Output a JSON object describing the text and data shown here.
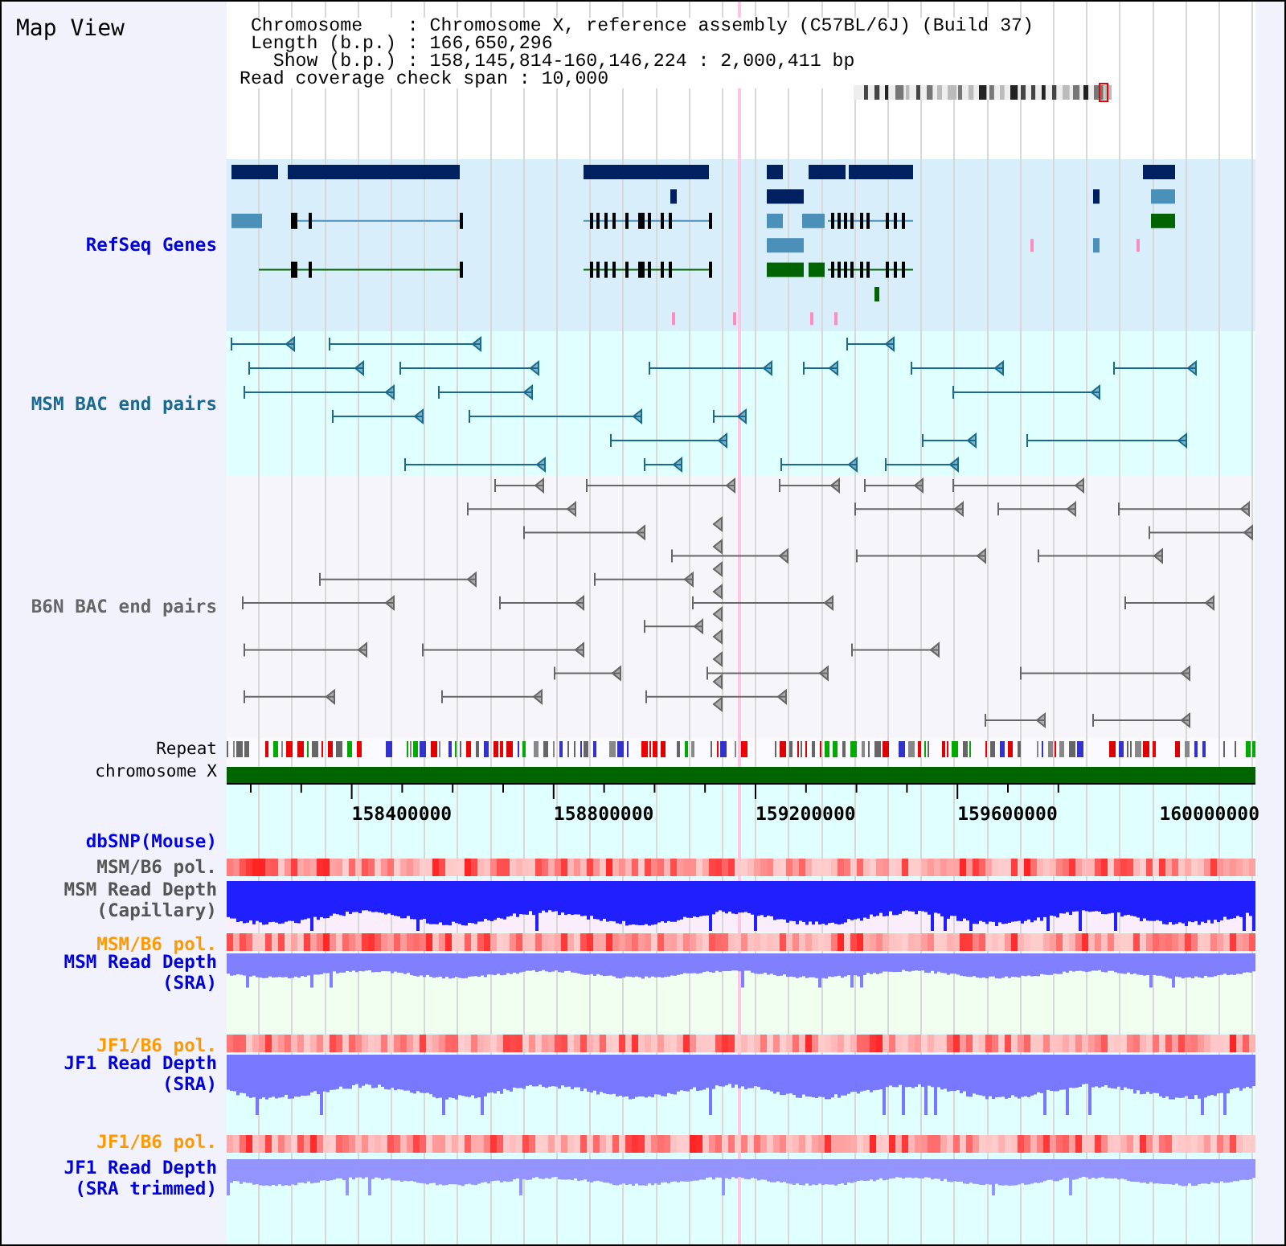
{
  "title": "Map View",
  "info": [
    " Chromosome    : Chromosome X, reference assembly (C57BL/6J) (Build 37)",
    " Length (b.p.) : 166,650,296",
    "   Show (b.p.) : 158,145,814-160,146,224 : 2,000,411 bp",
    "Read coverage check span : 10,000"
  ],
  "tracks": [
    {
      "kind": "genes",
      "label": "RefSeq Genes",
      "color": "#0000dd"
    },
    {
      "kind": "bac",
      "label": "MSM BAC end pairs",
      "color": "#1a6a90"
    },
    {
      "kind": "bac",
      "label": "B6N BAC end pairs",
      "color": "#666666"
    },
    {
      "kind": "repeat",
      "label": "Repeat",
      "color": "#000000"
    },
    {
      "kind": "chromosome",
      "label": "chromosome X",
      "color": "#000000"
    },
    {
      "kind": "axis",
      "ticks": [
        "158400000",
        "158800000",
        "159200000",
        "159600000",
        "160000000"
      ]
    },
    {
      "kind": "snp",
      "label": "dbSNP(Mouse)",
      "color": "#0000ee"
    },
    {
      "kind": "pol",
      "label": "MSM/B6 pol.",
      "color": "#555555"
    },
    {
      "kind": "depth",
      "label": "MSM Read Depth (Capillary)",
      "color": "#555555"
    },
    {
      "kind": "pol",
      "label": "MSM/B6 pol.",
      "color": "#ff9900"
    },
    {
      "kind": "depth",
      "label": "MSM Read Depth (SRA)",
      "color": "#0000dd"
    },
    {
      "kind": "pol",
      "label": "JF1/B6 pol.",
      "color": "#ff9900"
    },
    {
      "kind": "depth",
      "label": "JF1 Read Depth (SRA)",
      "color": "#0000dd"
    },
    {
      "kind": "pol",
      "label": "JF1/B6 pol.",
      "color": "#ff9900"
    },
    {
      "kind": "depth",
      "label": "JF1 Read Depth (SRA trimmed)",
      "color": "#0000dd"
    }
  ]
}
